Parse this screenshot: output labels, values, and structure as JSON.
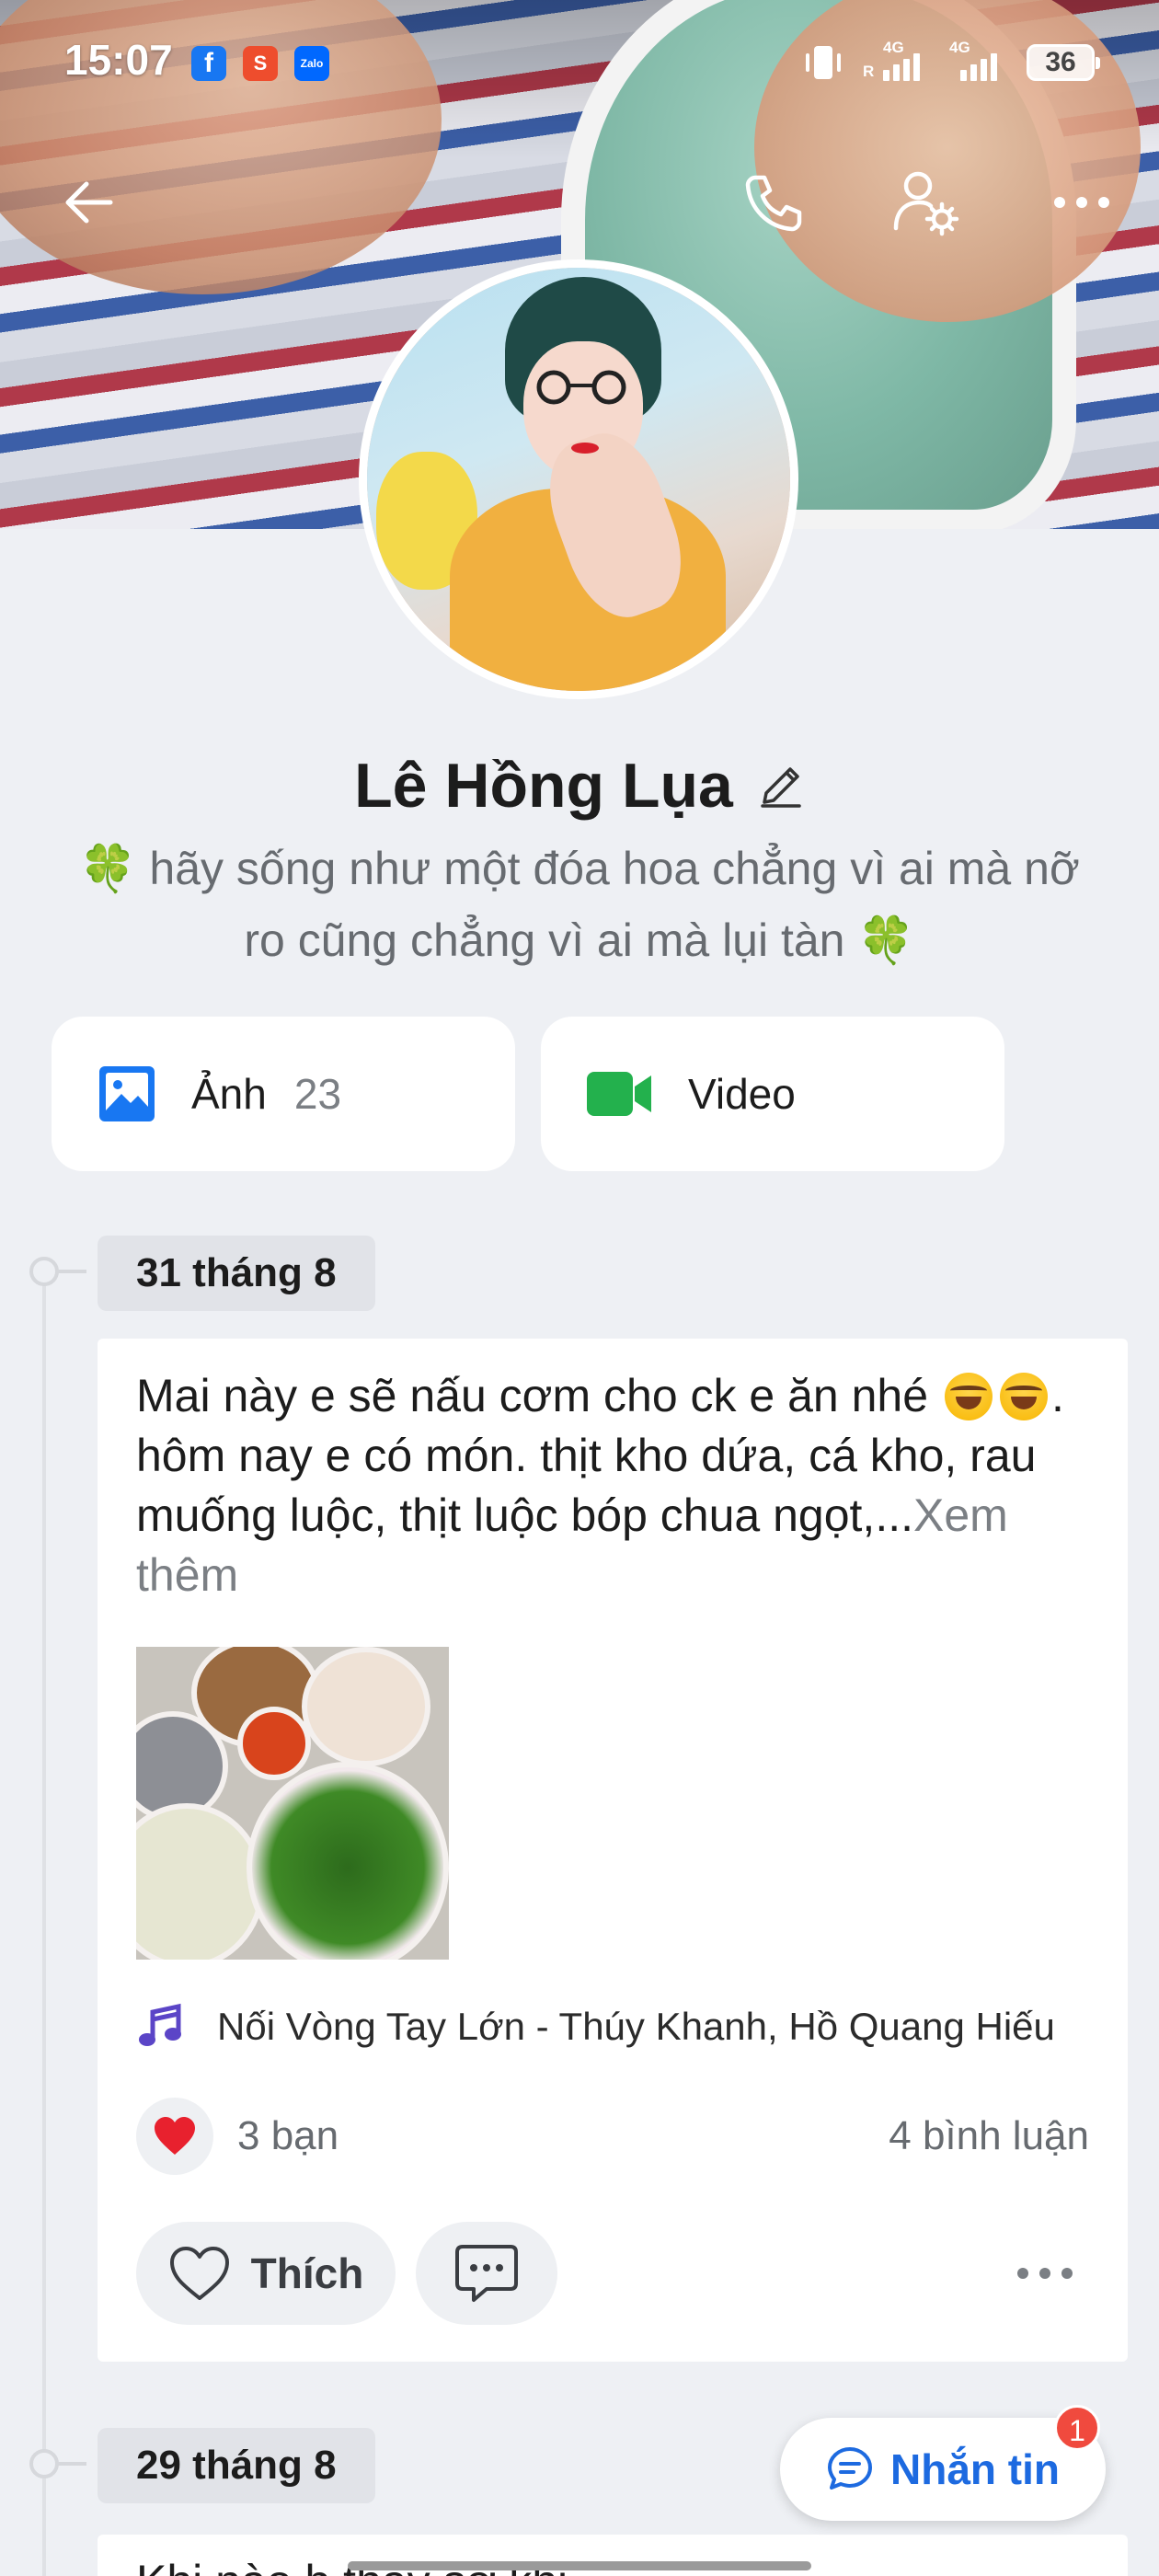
{
  "status_bar": {
    "time": "15:07",
    "apps": [
      {
        "name": "facebook",
        "glyph": "f",
        "color": "#1877f2"
      },
      {
        "name": "shopee",
        "glyph": "S",
        "color": "#ee4d2d"
      },
      {
        "name": "zalo",
        "glyph": "Zalo",
        "color": "#0068ff"
      }
    ],
    "network_1": "4G",
    "roaming": "R",
    "network_2": "4G",
    "battery": "36"
  },
  "nav": {
    "back_icon": "arrow-left-icon",
    "call_icon": "phone-icon",
    "settings_icon": "user-settings-icon",
    "more_icon": "more-horizontal-icon"
  },
  "profile": {
    "name": "Lê Hồng Lụa",
    "bio": "🍀 hãy sống như một đóa hoa chẳng vì ai mà nỡ ro cũng chẳng vì ai mà lụi tàn 🍀"
  },
  "media": {
    "photos_label": "Ảnh",
    "photos_count": "23",
    "video_label": "Video",
    "photo_icon_color": "#1877f2",
    "video_icon_color": "#23b14d"
  },
  "timeline": {
    "date_1": "31 tháng 8",
    "date_2": "29 tháng 8"
  },
  "post": {
    "text_part_1": "Mai này e sẽ nấu cơm cho ck e ăn nhé ",
    "text_part_2": ". hôm nay e có món. thịt kho dứa, cá kho, rau muống luộc, thịt luộc bóp chua ngọt,...",
    "see_more": "Xem thêm",
    "music": "Nối Vòng Tay Lớn - Thúy Khanh, Hồ Quang Hiếu",
    "reaction_count": "3 bạn",
    "comment_count": "4 bình luận",
    "like_label": "Thích"
  },
  "post_2": {
    "peek_text": "Khi nào b thấy sợ khi..."
  },
  "message_button": {
    "label": "Nhắn tin",
    "badge": "1"
  },
  "colors": {
    "accent": "#1d6ae0",
    "heart": "#e8212e",
    "music_icon": "#5b45c7"
  }
}
